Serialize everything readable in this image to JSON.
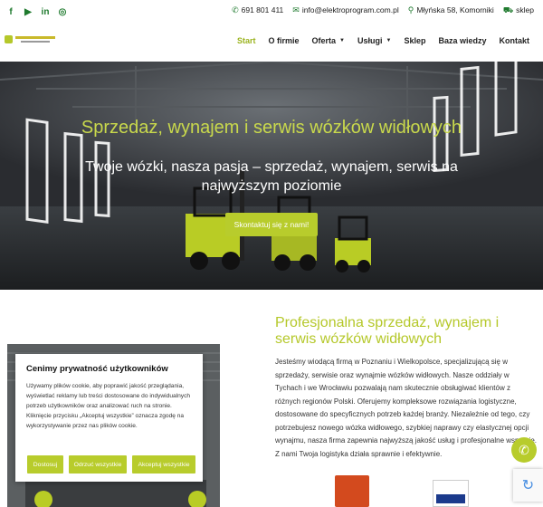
{
  "topbar": {
    "social": [
      {
        "icon": "facebook-icon",
        "glyph": "f"
      },
      {
        "icon": "youtube-icon",
        "glyph": "▶"
      },
      {
        "icon": "linkedin-icon",
        "glyph": "in"
      },
      {
        "icon": "instagram-icon",
        "glyph": "◎"
      }
    ],
    "phone": "691 801 411",
    "email": "info@elektroprogram.com.pl",
    "address": "Młyńska 58, Komorniki",
    "shop": "sklep"
  },
  "nav": {
    "items": [
      {
        "label": "Start",
        "active": true
      },
      {
        "label": "O firmie"
      },
      {
        "label": "Oferta",
        "dropdown": true
      },
      {
        "label": "Usługi",
        "dropdown": true
      },
      {
        "label": "Sklep"
      },
      {
        "label": "Baza wiedzy"
      },
      {
        "label": "Kontakt"
      }
    ]
  },
  "hero": {
    "title": "Sprzedaż, wynajem i serwis wózków widłowych",
    "subtitle": "Twoje wózki, nasza pasja – sprzedaż, wynajem, serwis na najwyższym poziomie",
    "cta": "Skontaktuj się z nami!"
  },
  "about": {
    "title": "Profesjonalna sprzedaż, wynajem i serwis wózków widłowych",
    "text": "Jesteśmy wiodącą firmą w Poznaniu i Wielkopolsce, specjalizującą się w sprzedaży, serwisie oraz wynajmie wózków widłowych. Nasze oddziały w Tychach i we Wrocławiu pozwalają nam skutecznie obsługiwać klientów z różnych regionów Polski. Oferujemy kompleksowe rozwiązania logistyczne, dostosowane do specyficznych potrzeb każdej branży. Niezależnie od tego, czy potrzebujesz nowego wózka widłowego, szybkiej naprawy czy elastycznej opcji wynajmu, nasza firma zapewnia najwyższą jakość usług i profesjonalne wsparcie. Z nami Twoja logistyka działa sprawnie i efektywnie."
  },
  "cookie": {
    "title": "Cenimy prywatność użytkowników",
    "text": "Używamy plików cookie, aby poprawić jakość przeglądania, wyświetlać reklamy lub treści dostosowane do indywidualnych potrzeb użytkowników oraz analizować ruch na stronie. Kliknięcie przycisku „Akceptuj wszystkie” oznacza zgodę na wykorzystywanie przez nas plików cookie.",
    "buttons": {
      "customize": "Dostosuj",
      "reject": "Odrzuć wszystkie",
      "accept": "Akceptuj wszystkie"
    }
  },
  "colors": {
    "accent": "#b8cc2c",
    "icon_green": "#1f7a2e"
  }
}
